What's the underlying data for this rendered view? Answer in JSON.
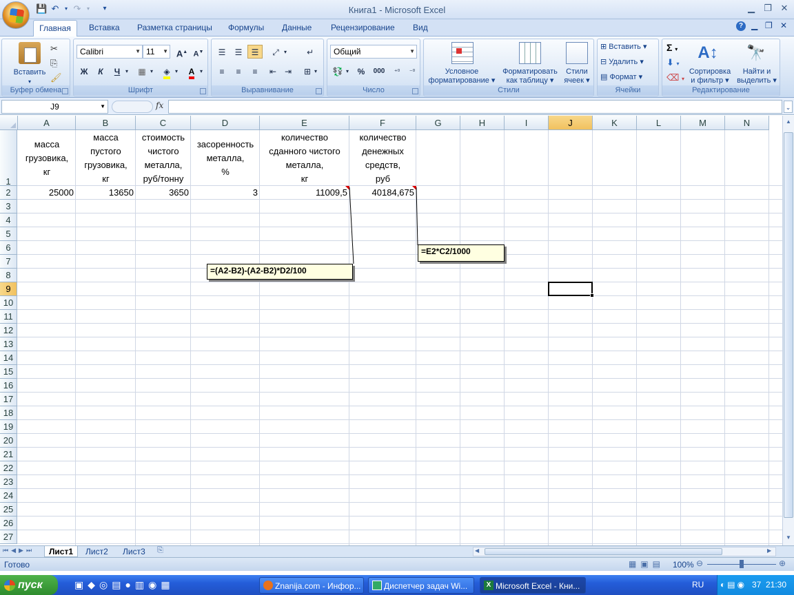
{
  "window": {
    "title": "Книга1 - Microsoft Excel"
  },
  "ribbon_tabs": [
    "Главная",
    "Вставка",
    "Разметка страницы",
    "Формулы",
    "Данные",
    "Рецензирование",
    "Вид"
  ],
  "groups": {
    "clipboard": {
      "label": "Буфер обмена",
      "paste": "Вставить"
    },
    "font": {
      "label": "Шрифт",
      "font_name": "Calibri",
      "font_size": "11",
      "bold": "Ж",
      "italic": "К",
      "underline": "Ч"
    },
    "alignment": {
      "label": "Выравнивание"
    },
    "number": {
      "label": "Число",
      "format": "Общий",
      "percent": "%",
      "thousands": "000"
    },
    "styles": {
      "label": "Стили",
      "conditional_1": "Условное",
      "conditional_2": "форматирование",
      "format_table_1": "Форматировать",
      "format_table_2": "как таблицу",
      "cell_styles_1": "Стили",
      "cell_styles_2": "ячеек"
    },
    "cells": {
      "label": "Ячейки",
      "insert": "Вставить",
      "delete": "Удалить",
      "format": "Формат"
    },
    "editing": {
      "label": "Редактирование",
      "sort_1": "Сортировка",
      "sort_2": "и фильтр",
      "find_1": "Найти и",
      "find_2": "выделить"
    }
  },
  "formula_bar": {
    "name_box": "J9",
    "fx": "fx",
    "value": ""
  },
  "columns": [
    "A",
    "B",
    "C",
    "D",
    "E",
    "F",
    "G",
    "H",
    "I",
    "J",
    "K",
    "L",
    "M",
    "N"
  ],
  "rows": [
    "1",
    "2",
    "3",
    "4",
    "5",
    "6",
    "7",
    "8",
    "9",
    "10",
    "11",
    "12",
    "13",
    "14",
    "15",
    "16",
    "17",
    "18",
    "19",
    "20",
    "21",
    "22",
    "23",
    "24",
    "25",
    "26",
    "27"
  ],
  "headers": {
    "A": "масса\nгрузовика,\nкг",
    "B": "масса\nпустого\nгрузовика,\nкг",
    "C": "стоимость\nчистого\nметалла,\nруб/тонну",
    "D": "засоренность\nметалла,\n%",
    "E": "количество\nсданного чистого\nметалла,\nкг",
    "F": "количество\nденежных\nсредств,\nруб"
  },
  "values": {
    "A": "25000",
    "B": "13650",
    "C": "3650",
    "D": "3",
    "E": "11009,5",
    "F": "40184,675"
  },
  "comments": {
    "E2": "=(A2-B2)-(A2-B2)*D2/100",
    "F2": "=E2*C2/1000"
  },
  "sheets": [
    "Лист1",
    "Лист2",
    "Лист3"
  ],
  "status": {
    "ready": "Готово",
    "zoom": "100%"
  },
  "taskbar": {
    "start": "пуск",
    "windows": [
      "Znanija.com - Инфор...",
      "Диспетчер задач Wi...",
      "Microsoft Excel - Кни..."
    ],
    "lang": "RU",
    "num": "37",
    "clock": "21:30"
  }
}
